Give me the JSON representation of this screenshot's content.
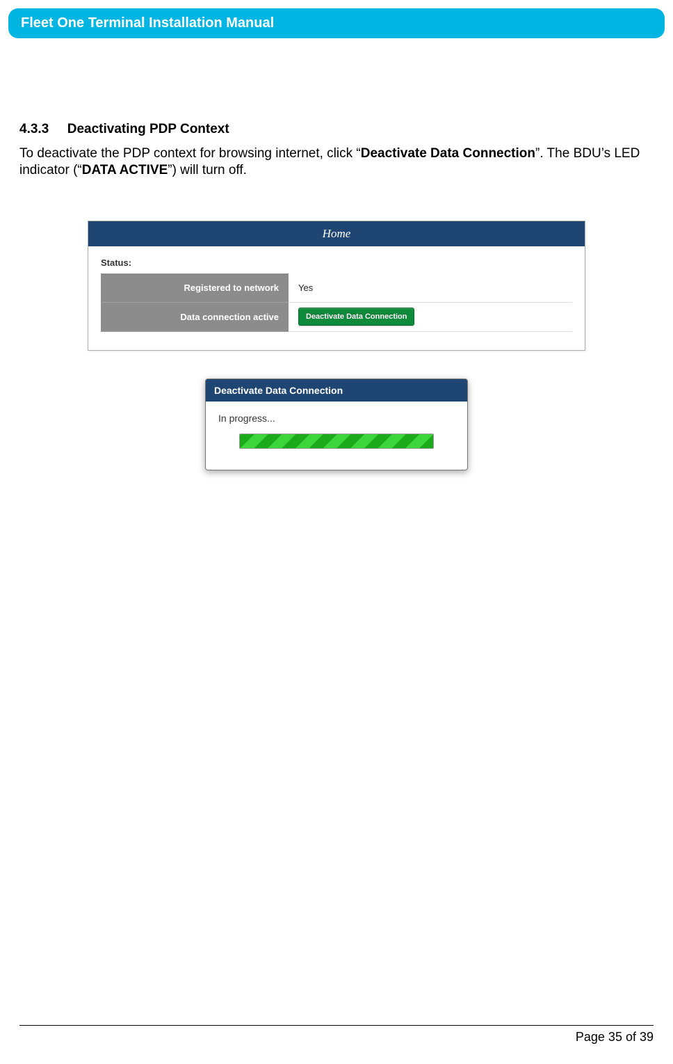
{
  "header": {
    "title": "Fleet One Terminal Installation Manual"
  },
  "section": {
    "number": "4.3.3",
    "title": "Deactivating PDP Context"
  },
  "body": {
    "p1a": "To deactivate the PDP context for browsing internet, click “",
    "p1b": "Deactivate Data Connection",
    "p1c": "”. The BDU’s LED indicator (“",
    "p1d": "DATA ACTIVE",
    "p1e": "”) will turn off."
  },
  "fig1": {
    "title": "Home",
    "statusLabel": "Status:",
    "rows": [
      {
        "key": "Registered to network",
        "value": "Yes"
      },
      {
        "key": "Data connection active",
        "value": ""
      }
    ],
    "button": "Deactivate Data Connection"
  },
  "fig2": {
    "title": "Deactivate Data Connection",
    "message": "In progress..."
  },
  "footer": {
    "page": "Page 35 of 39"
  }
}
